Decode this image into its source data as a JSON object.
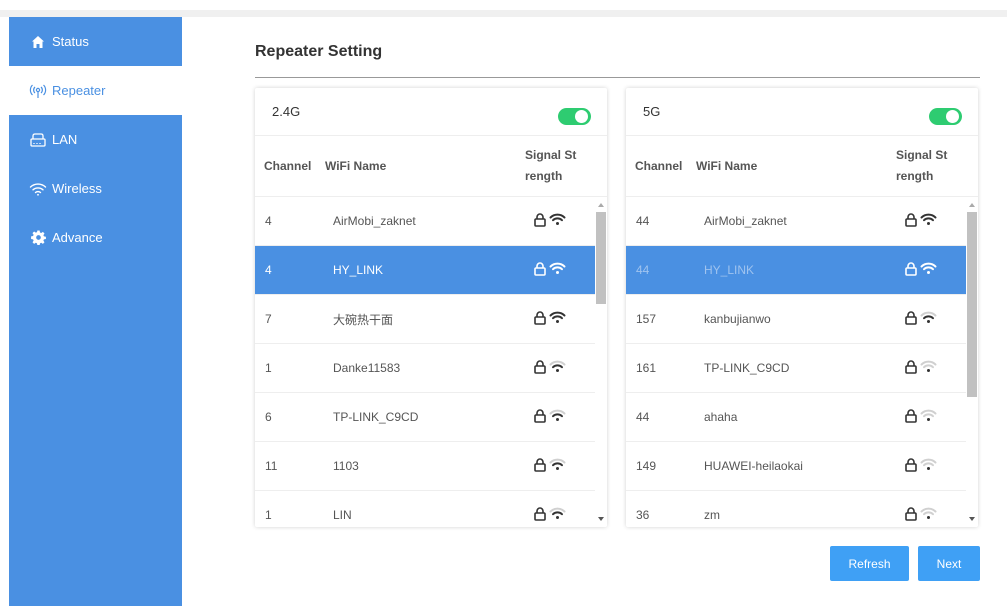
{
  "sidebar": {
    "items": [
      {
        "label": "Status",
        "icon": "home-icon"
      },
      {
        "label": "Repeater",
        "icon": "antenna-icon"
      },
      {
        "label": "LAN",
        "icon": "router-icon"
      },
      {
        "label": "Wireless",
        "icon": "wifi-icon"
      },
      {
        "label": "Advance",
        "icon": "gear-icon"
      }
    ]
  },
  "page": {
    "title": "Repeater Setting"
  },
  "columns": {
    "channel": "Channel",
    "wifi_name": "WiFi Name",
    "signal_1": "Signal St",
    "signal_2": "rength"
  },
  "band24": {
    "label": "2.4G",
    "rows": [
      {
        "channel": "4",
        "name": "AirMobi_zaknet",
        "signal": 3
      },
      {
        "channel": "4",
        "name": "HY_LINK",
        "signal": 3
      },
      {
        "channel": "7",
        "name": "大碗热干面",
        "signal": 3
      },
      {
        "channel": "1",
        "name": "Danke11583",
        "signal": 2
      },
      {
        "channel": "6",
        "name": "TP-LINK_C9CD",
        "signal": 2
      },
      {
        "channel": "11",
        "name": "1103",
        "signal": 2
      },
      {
        "channel": "1",
        "name": "LIN",
        "signal": 2
      }
    ]
  },
  "band5": {
    "label": "5G",
    "rows": [
      {
        "channel": "44",
        "name": "AirMobi_zaknet",
        "signal": 3
      },
      {
        "channel": "44",
        "name": "HY_LINK",
        "signal": 3
      },
      {
        "channel": "157",
        "name": "kanbujianwo",
        "signal": 2
      },
      {
        "channel": "161",
        "name": "TP-LINK_C9CD",
        "signal": 1
      },
      {
        "channel": "44",
        "name": "ahaha",
        "signal": 1
      },
      {
        "channel": "149",
        "name": "HUAWEI-heilaokai",
        "signal": 1
      },
      {
        "channel": "36",
        "name": "zm",
        "signal": 1
      }
    ]
  },
  "buttons": {
    "refresh": "Refresh",
    "next": "Next"
  },
  "colors": {
    "accent": "#4a90e2",
    "toggle_on": "#2ecc71",
    "button": "#3fa0f5"
  }
}
